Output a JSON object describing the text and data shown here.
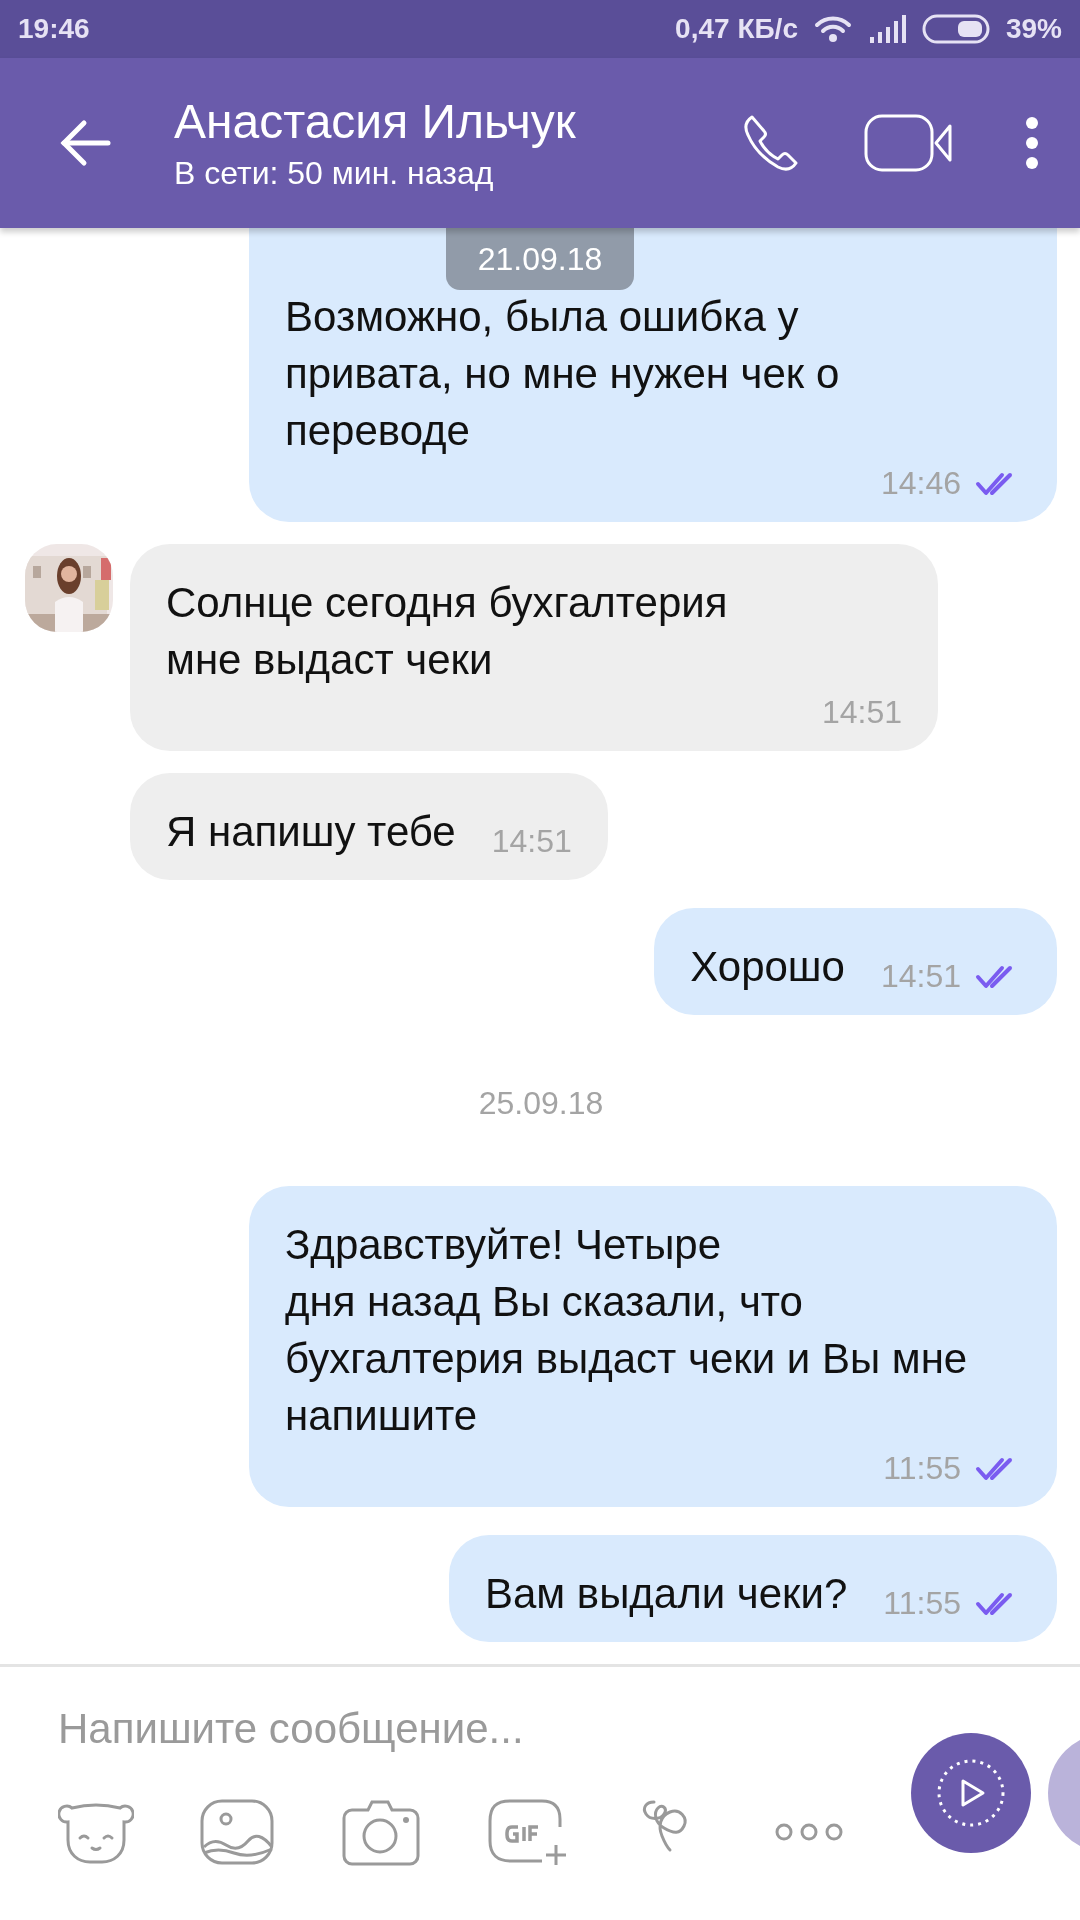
{
  "status_bar": {
    "time": "19:46",
    "network_speed": "0,47 КБ/с",
    "battery": "39%"
  },
  "header": {
    "title": "Анастасия Ильчук",
    "subtitle": "В сети: 50 мин. назад"
  },
  "date_overlay": "21.09.18",
  "messages": [
    {
      "kind": "outgoing",
      "text": "Возможно, была ошибка у привата, но мне нужен чек о переводе",
      "time": "14:46",
      "read": true
    },
    {
      "kind": "incoming",
      "text": "Солнце сегодня бухгалтерия мне выдаст чеки",
      "time": "14:51",
      "avatar": true
    },
    {
      "kind": "incoming",
      "text": "Я напишу тебе",
      "time": "14:51",
      "avatar": false
    },
    {
      "kind": "outgoing",
      "text": "Хорошо",
      "time": "14:51",
      "read": true
    },
    {
      "kind": "date",
      "text": "25.09.18"
    },
    {
      "kind": "outgoing",
      "text": "Здравствуйте! Четыре\nдня назад Вы сказали, что бухгалтерия выдаст чеки и Вы мне напишите",
      "time": "11:55",
      "read": true
    },
    {
      "kind": "outgoing",
      "text": "Вам выдали чеки?",
      "time": "11:55",
      "read": true
    }
  ],
  "composer": {
    "placeholder": "Напишите сообщение..."
  }
}
